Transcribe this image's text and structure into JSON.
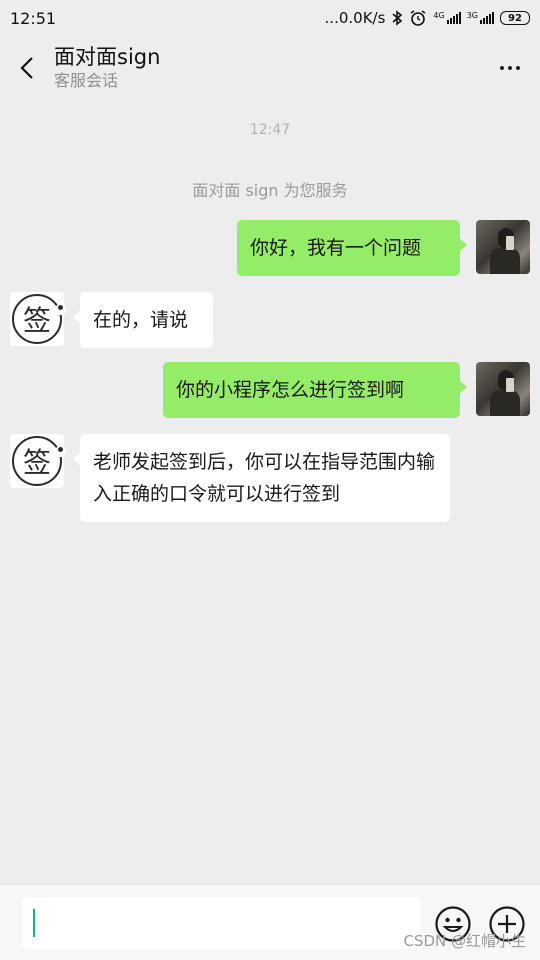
{
  "status_bar": {
    "time": "12:51",
    "speed": "...0.0K/s",
    "net1": "4G",
    "net2": "3G",
    "battery": "92"
  },
  "header": {
    "title": "面对面sign",
    "subtitle": "客服会话"
  },
  "chat": {
    "timestamp": "12:47",
    "system_message": "面对面 sign 为您服务",
    "messages": [
      {
        "from": "me",
        "text": "你好，我有一个问题"
      },
      {
        "from": "bot",
        "text": "在的，请说"
      },
      {
        "from": "me",
        "text": "你的小程序怎么进行签到啊"
      },
      {
        "from": "bot",
        "text": "老师发起签到后，你可以在指导范围内输入正确的口令就可以进行签到"
      }
    ],
    "bot_avatar_glyph": "签"
  },
  "input": {
    "value": ""
  },
  "watermark": "CSDN @红帽小生",
  "colors": {
    "my_bubble": "#95ec69",
    "their_bubble": "#ffffff",
    "background": "#ededed",
    "caret": "#07c160"
  }
}
